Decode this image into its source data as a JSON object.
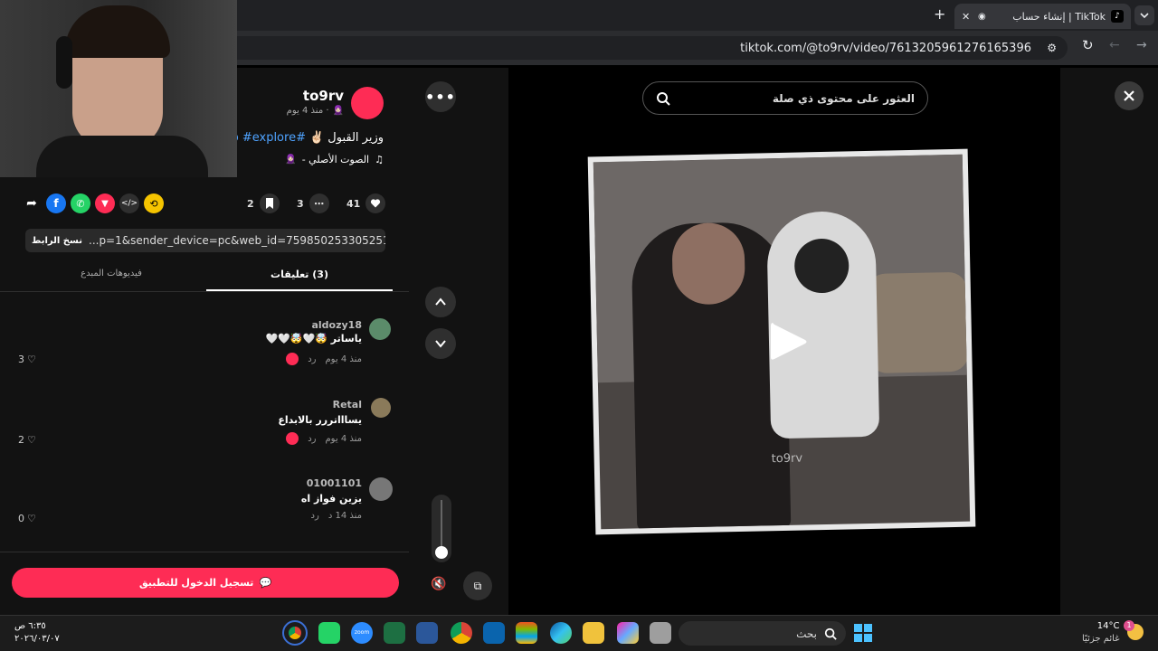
{
  "browser": {
    "tab_title": "إنشاء حساب | TikTok",
    "url": "tiktok.com/@to9rv/video/7613205961276165396",
    "new_tab_symbol": "+",
    "close_symbol": "✕"
  },
  "search": {
    "placeholder": "العثور على محتوى ذي صلة"
  },
  "post": {
    "username": "to9rv",
    "time": "· منذ 4 يوم",
    "caption_text": "وزير القبول ✌🏻",
    "caption_tags": "#fyp #explore",
    "sound": "الصوت الأصلي -",
    "likes": "41",
    "comments": "3",
    "saves": "2",
    "share_link": "...p=1&sender_device=pc&web_id=7598502533052515858",
    "copy_link_label": "نسخ الرابط"
  },
  "tabs": {
    "comments": "(3) تعليقات",
    "creator_videos": "فيديوهات المبدع"
  },
  "comments": [
    {
      "name": "aldozy18",
      "text": "ياساتر 🤯🤍🤯🤍🤍",
      "time": "منذ 4 يوم",
      "reply": "رد",
      "likes": "3",
      "avatar_color": "#5b8c6a"
    },
    {
      "name": "Retal",
      "text": "يساااتررر بالابداع",
      "time": "منذ 4 يوم",
      "reply": "رد",
      "likes": "2",
      "avatar_color": "#8a7a5a"
    },
    {
      "name": "01001101",
      "text": "يزين فواز اه",
      "time": "منذ 14 د",
      "reply": "رد",
      "likes": "0",
      "avatar_color": "#777777"
    }
  ],
  "login_button": "تسجيل الدخول للتطبيق",
  "video": {
    "watermark": "to9rv"
  },
  "taskbar": {
    "search_placeholder": "بحث",
    "weather_temp": "14°C",
    "weather_desc": "غائم جزئيًا",
    "notification_count": "1",
    "clock_time": "٦:٣٥ ص",
    "clock_date": "٢٠٢٦/٠٣/٠٧"
  },
  "colors": {
    "accent": "#fe2c55",
    "tag_blue": "#4fa3ff",
    "panel_bg": "#121212"
  },
  "icons": [
    "search-icon",
    "close-icon",
    "more-icon",
    "up-arrow-icon",
    "down-arrow-icon",
    "mute-icon",
    "pip-icon",
    "play-icon",
    "heart-icon",
    "comment-icon",
    "bookmark-icon",
    "share-icon"
  ]
}
